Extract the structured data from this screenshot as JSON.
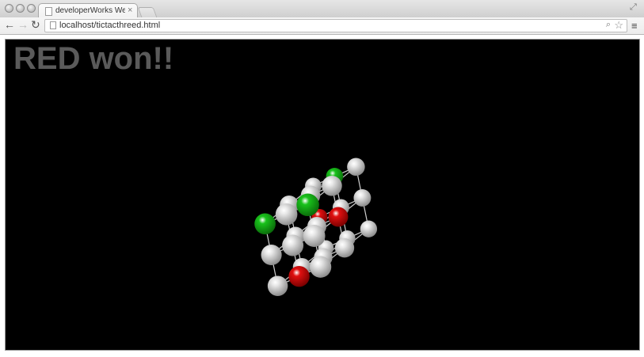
{
  "browser": {
    "tab_title": "developerWorks WebGL Ti",
    "tab_close": "×",
    "url": "localhost/tictacthreed.html"
  },
  "game": {
    "status": "RED won!!",
    "colors": {
      "red": "#e01010",
      "green": "#19c21b",
      "white": "#e8e8e8"
    },
    "cells": [
      {
        "color": "white"
      },
      {
        "color": "white"
      },
      {
        "color": "white"
      },
      {
        "color": "red"
      },
      {
        "color": "white"
      },
      {
        "color": "white"
      },
      {
        "color": "white"
      },
      {
        "color": "white"
      },
      {
        "color": "green"
      },
      {
        "color": "white"
      },
      {
        "color": "white"
      },
      {
        "color": "red"
      },
      {
        "color": "white"
      },
      {
        "color": "white"
      },
      {
        "color": "white"
      },
      {
        "color": "green"
      },
      {
        "color": "white"
      },
      {
        "color": "white"
      },
      {
        "color": "white"
      },
      {
        "color": "white"
      },
      {
        "color": "white"
      },
      {
        "color": "white"
      },
      {
        "color": "red"
      },
      {
        "color": "white"
      },
      {
        "color": "white"
      },
      {
        "color": "white"
      },
      {
        "color": "green"
      }
    ]
  }
}
